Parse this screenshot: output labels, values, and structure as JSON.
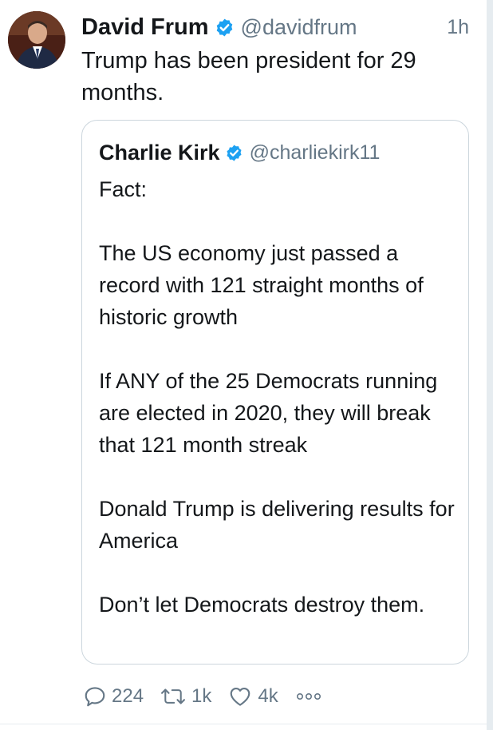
{
  "tweet": {
    "author_name": "David Frum",
    "author_handle": "@davidfrum",
    "timestamp": "1h",
    "text": "Trump has been president for 29 months."
  },
  "quoted_tweet": {
    "author_name": "Charlie Kirk",
    "author_handle": "@charliekirk11",
    "paragraphs": [
      "Fact:",
      "The US economy just passed a record with 121 straight months of historic growth",
      "If ANY of the 25 Democrats running are elected in 2020, they will break that 121 month streak",
      "Donald Trump is delivering results for America",
      "Don’t let Democrats destroy them."
    ]
  },
  "actions": {
    "replies": "224",
    "retweets": "1k",
    "likes": "4k"
  },
  "icons": {
    "verified": "verified-badge-icon",
    "reply": "reply-icon",
    "retweet": "retweet-icon",
    "like": "heart-icon",
    "more": "more-dots-icon"
  },
  "colors": {
    "verified_blue": "#1da1f2",
    "secondary_text": "#657786",
    "border": "#ccd6dd"
  }
}
